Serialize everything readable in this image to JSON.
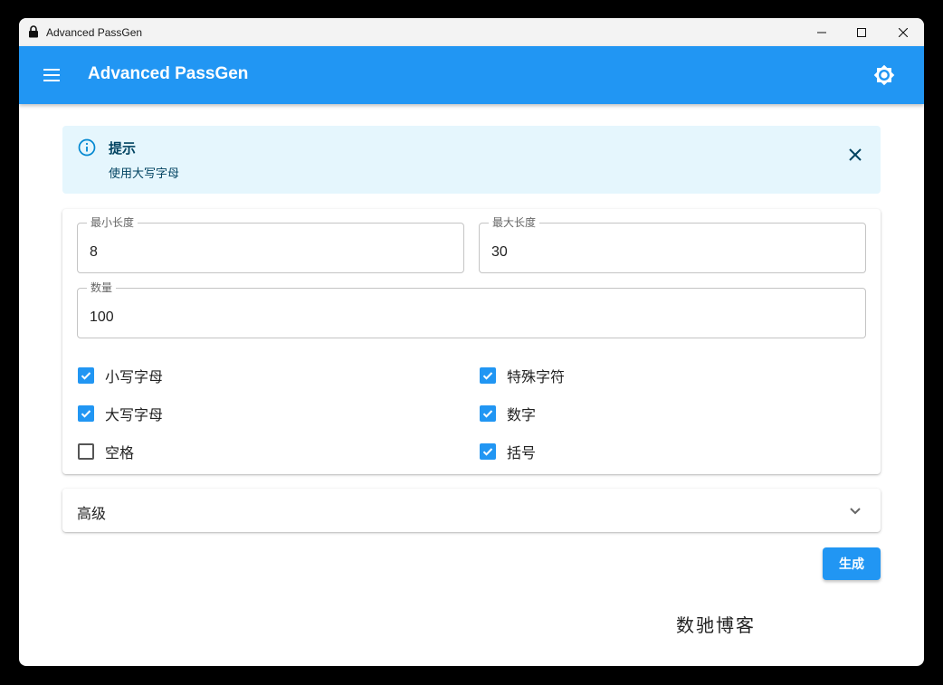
{
  "window": {
    "title": "Advanced PassGen"
  },
  "appbar": {
    "title": "Advanced PassGen",
    "menu_icon": "menu-icon",
    "theme_icon": "brightness-icon"
  },
  "alert": {
    "title": "提示",
    "message": "使用大写字母",
    "icon": "info-icon"
  },
  "fields": {
    "min_length": {
      "label": "最小长度",
      "value": "8"
    },
    "max_length": {
      "label": "最大长度",
      "value": "30"
    },
    "count": {
      "label": "数量",
      "value": "100"
    }
  },
  "options": [
    {
      "label": "小写字母",
      "checked": true
    },
    {
      "label": "特殊字符",
      "checked": true
    },
    {
      "label": "大写字母",
      "checked": true
    },
    {
      "label": "数字",
      "checked": true
    },
    {
      "label": "空格",
      "checked": false
    },
    {
      "label": "括号",
      "checked": true
    }
  ],
  "advanced": {
    "label": "高级"
  },
  "generate_label": "生成",
  "watermark": "数驰博客",
  "colors": {
    "primary": "#2196f3",
    "alert_bg": "#e5f6fd",
    "alert_text": "#014361"
  }
}
